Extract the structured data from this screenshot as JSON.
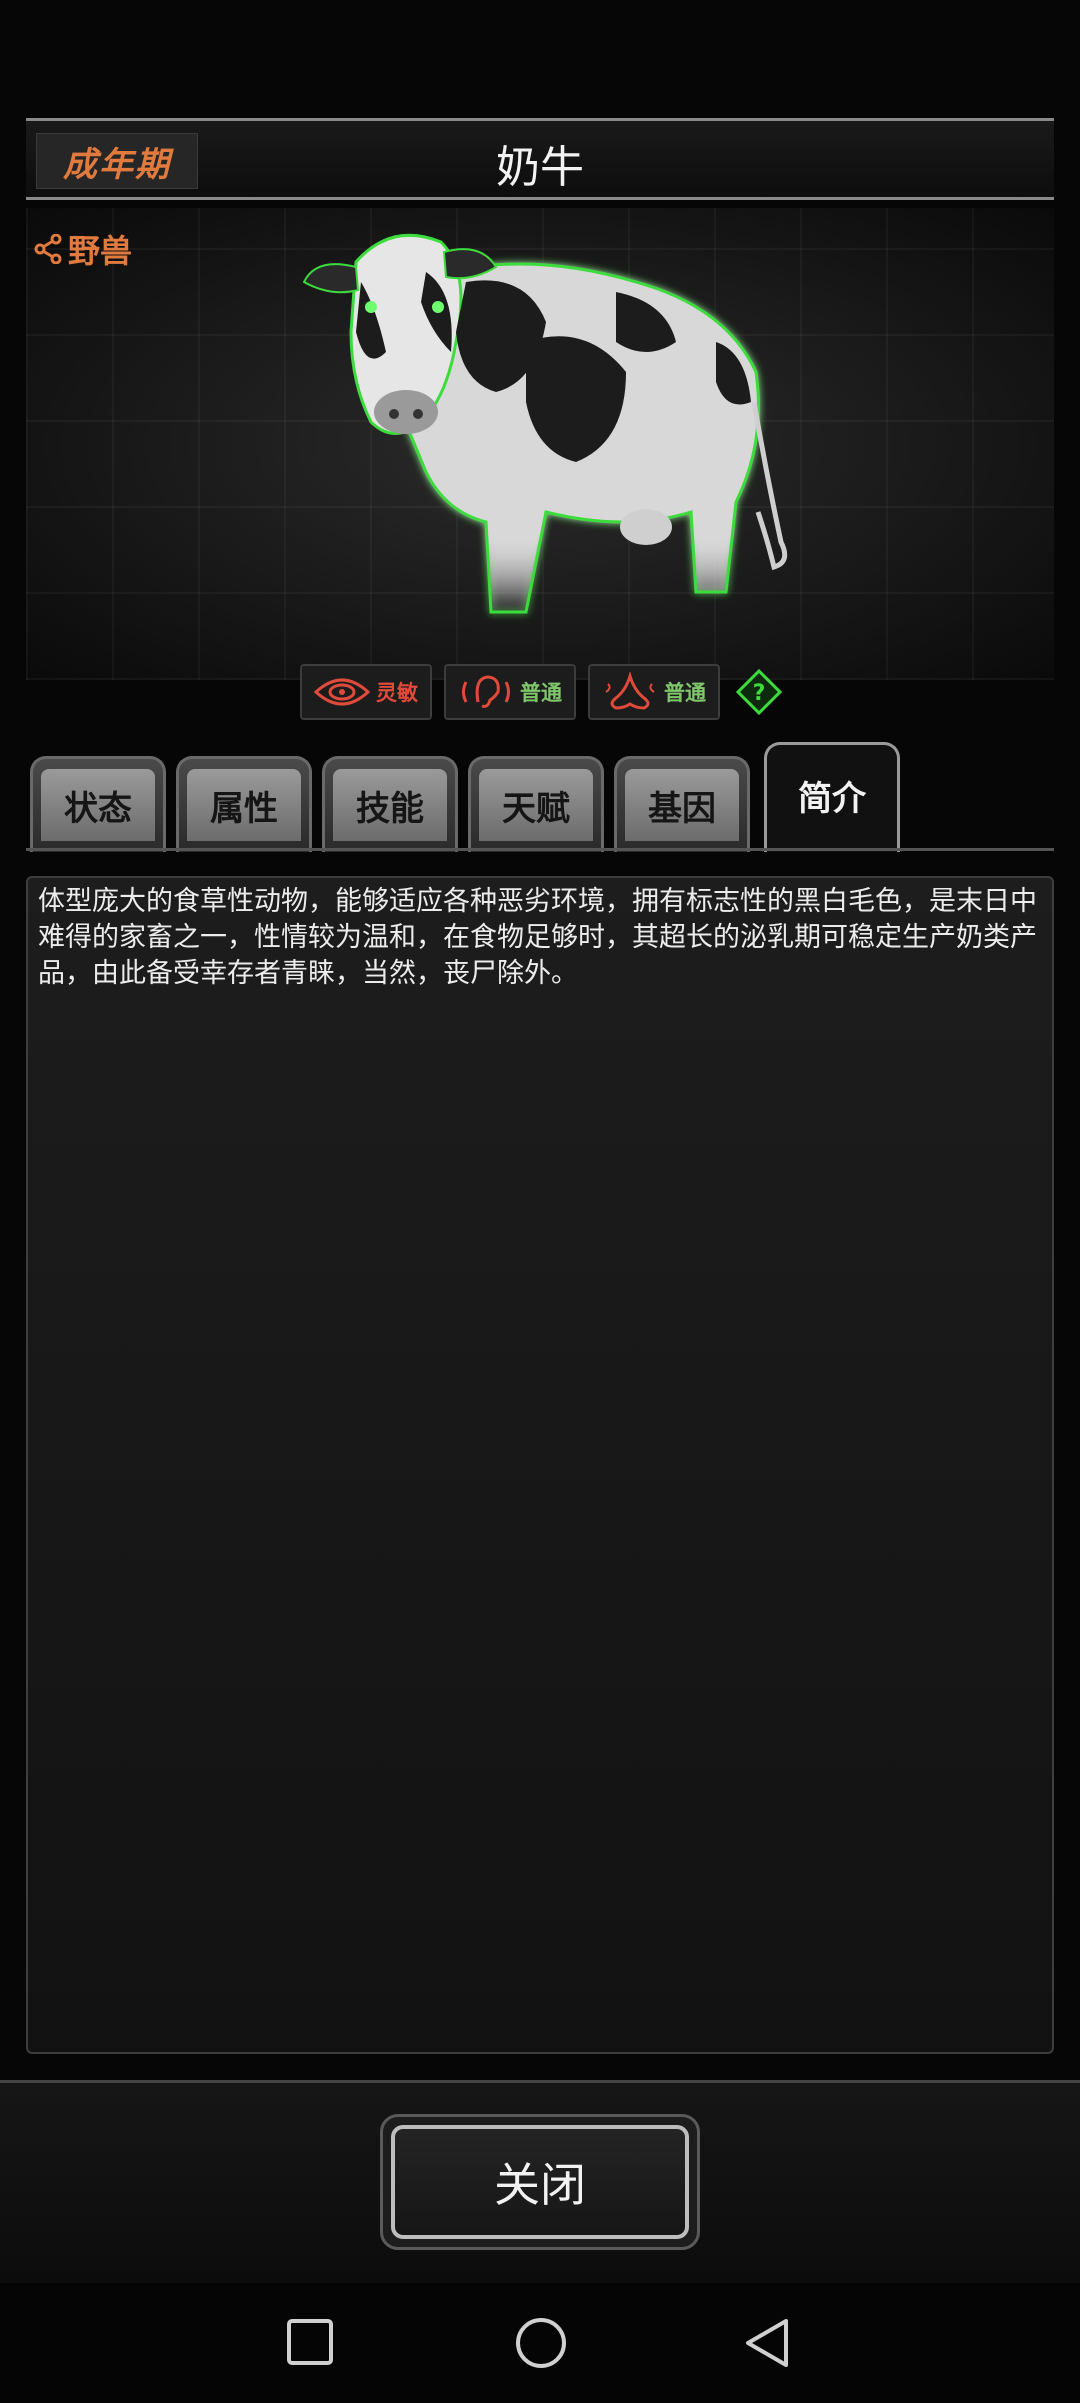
{
  "header": {
    "stage": "成年期",
    "title": "奶牛"
  },
  "creature": {
    "category": "野兽",
    "image": "cow-portrait",
    "senses": [
      {
        "icon": "eye-icon",
        "label": "灵敏",
        "color": "#e04a3a"
      },
      {
        "icon": "ear-icon",
        "label": "普通",
        "color": "#7fc66a"
      },
      {
        "icon": "nose-icon",
        "label": "普通",
        "color": "#7fc66a"
      }
    ],
    "help_icon": "question-icon"
  },
  "tabs": [
    {
      "label": "状态"
    },
    {
      "label": "属性"
    },
    {
      "label": "技能"
    },
    {
      "label": "天赋"
    },
    {
      "label": "基因"
    },
    {
      "label": "简介"
    }
  ],
  "active_tab": "简介",
  "description": "体型庞大的食草性动物，能够适应各种恶劣环境，拥有标志性的黑白毛色，是末日中难得的家畜之一，性情较为温和，在食物足够时，其超长的泌乳期可稳定生产奶类产品，由此备受幸存者青睐，当然，丧尸除外。",
  "close_button": "关闭",
  "navbar": [
    "recent-apps-icon",
    "home-icon",
    "back-icon"
  ]
}
